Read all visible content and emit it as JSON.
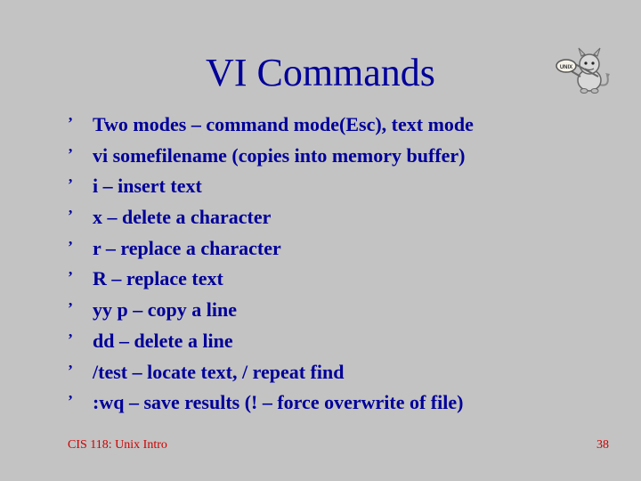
{
  "title": "VI Commands",
  "bullets": [
    "Two modes – command mode(Esc), text mode",
    "vi somefilename (copies into memory buffer)",
    "i – insert text",
    "x – delete a character",
    "r – replace a character",
    "R – replace text",
    "yy p – copy a line",
    "dd – delete a line",
    "/test – locate text, / repeat find",
    ":wq – save results (! – force overwrite of file)"
  ],
  "footer_left": "CIS 118: Unix Intro",
  "footer_right": "38",
  "bullet_marker": "’"
}
